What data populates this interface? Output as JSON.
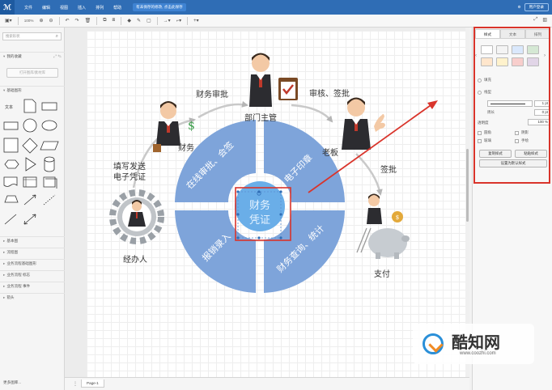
{
  "menubar": {
    "items": [
      "文件",
      "编辑",
      "视图",
      "插入",
      "排列",
      "帮助"
    ],
    "notice": "有未保存的修改, 点击此保存",
    "user_button": "用户登录",
    "colors": {
      "bar": "#2f6db5",
      "logo": "#1e5aa0"
    }
  },
  "toolbar": {
    "zoom": "100%"
  },
  "sidebar": {
    "search_placeholder": "搜索形状",
    "sections": {
      "favorites": "我的收藏",
      "basic": "基础图形",
      "basemap": "基本图",
      "flowchart": "流程图",
      "bpmn_basic": "业务流程基础图形",
      "bpmn_markers": "业务流程 标志",
      "bpmn_events": "业务流程 事件",
      "arrows": "箭头"
    },
    "open_library": "打开图库/素材库",
    "text_shape": "文本",
    "more_libraries": "更多图库..."
  },
  "bottombar": {
    "page_tab": "Page-1"
  },
  "diagram": {
    "center": [
      "财务",
      "凭证"
    ],
    "segments": [
      "在线审批、会签",
      "电子印章",
      "报销录入",
      "财务查询、统计"
    ],
    "roles": {
      "clerk": "经办人",
      "finance": "财务",
      "manager": "部门主管",
      "boss": "老板",
      "payment": "支付"
    },
    "flows": {
      "fill_voucher_1": "填写发送",
      "fill_voucher_2": "电子凭证",
      "finance_review": "财务审批",
      "review_sign": "审核、签批",
      "approve": "签批"
    },
    "colors": {
      "segment": "#7ea4da",
      "center": "#6aaee8",
      "center_text": "#e6f3ff",
      "highlight": "#d9342b"
    }
  },
  "right_panel": {
    "tabs": [
      "样式",
      "文本",
      "排列"
    ],
    "swatches": [
      "#ffffff",
      "#f4f4f4",
      "#dae8fc",
      "#d5e8d4",
      "#ffe6cc",
      "#fff2cc",
      "#f8cecc",
      "#e1d5e7"
    ],
    "fill_label": "填充",
    "line_label": "线型",
    "line_width": "1 pt",
    "perimeter_label": "周长",
    "perimeter_value": "0 pt",
    "opacity_label": "透明度",
    "opacity_value": "100 %",
    "rounded_label": "圆角",
    "shadow_label": "阴影",
    "glass_label": "玻璃",
    "sketch_label": "手绘",
    "copy_style": "复制样式",
    "paste_style": "粘贴样式",
    "set_default": "设置为默认样式"
  },
  "watermark": {
    "name": "酷知网",
    "url": "www.coozhi.com"
  }
}
